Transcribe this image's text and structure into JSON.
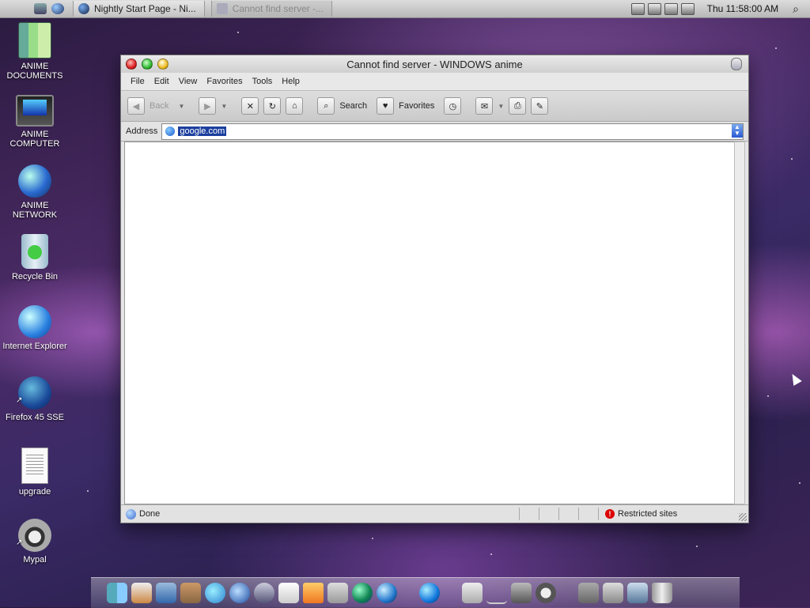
{
  "menubar": {
    "tasks": [
      {
        "label": "Nightly Start Page - Ni..."
      },
      {
        "label": "Cannot find server -..."
      }
    ],
    "clock": "Thu 11:58:00 AM"
  },
  "desktop_icons": [
    {
      "label": "ANIME DOCUMENTS",
      "icon": "folder-icon"
    },
    {
      "label": "ANIME COMPUTER",
      "icon": "computer-icon"
    },
    {
      "label": "ANIME NETWORK",
      "icon": "network-icon"
    },
    {
      "label": "Recycle Bin",
      "icon": "recycle-bin-icon"
    },
    {
      "label": "Internet Explorer",
      "icon": "internet-explorer-icon"
    },
    {
      "label": "Firefox 45 SSE",
      "icon": "firefox-icon"
    },
    {
      "label": "upgrade",
      "icon": "document-icon"
    },
    {
      "label": "Mypal",
      "icon": "mypal-icon"
    }
  ],
  "window": {
    "title": "Cannot find server - WINDOWS anime",
    "menu": [
      "File",
      "Edit",
      "View",
      "Favorites",
      "Tools",
      "Help"
    ],
    "toolbar": {
      "back": "Back",
      "search": "Search",
      "favorites": "Favorites"
    },
    "address": {
      "label": "Address",
      "value": "google.com"
    },
    "status": {
      "text": "Done",
      "zone": "Restricted sites"
    }
  }
}
